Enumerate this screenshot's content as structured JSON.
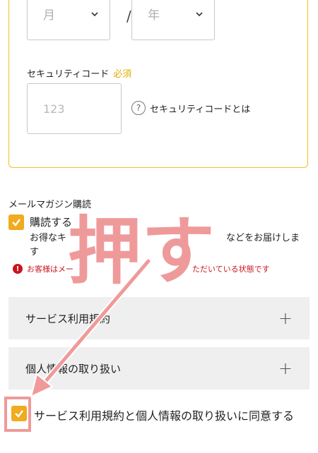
{
  "expiry": {
    "month_placeholder": "月",
    "separator": "/",
    "year_placeholder": "年"
  },
  "security": {
    "label": "セキュリティコード",
    "required": "必須",
    "placeholder": "123",
    "help_icon": "?",
    "help_text": "セキュリティコードとは"
  },
  "newsletter": {
    "title": "メールマガジン購読",
    "checkbox_label": "購読する",
    "desc_line1": "お得なキ",
    "desc_line1_end": "などをお届けしま",
    "desc_line2": "す",
    "warning_icon": "!",
    "warning": "お客様はメー",
    "warning_end": "ただいている状態です"
  },
  "accordions": [
    {
      "label": "サービス利用規約",
      "icon": "plus-icon",
      "symbol": "+"
    },
    {
      "label": "個人情報の取り扱い",
      "icon": "plus-icon",
      "symbol": "+"
    }
  ],
  "agreement": {
    "label": "サービス利用規約と個人情報の取り扱いに同意する"
  },
  "annotation": {
    "text": "押す",
    "color": "#ef9a9a"
  },
  "colors": {
    "accent": "#f0ab1e",
    "card_border": "#f0c419",
    "warning": "#c9151e"
  }
}
